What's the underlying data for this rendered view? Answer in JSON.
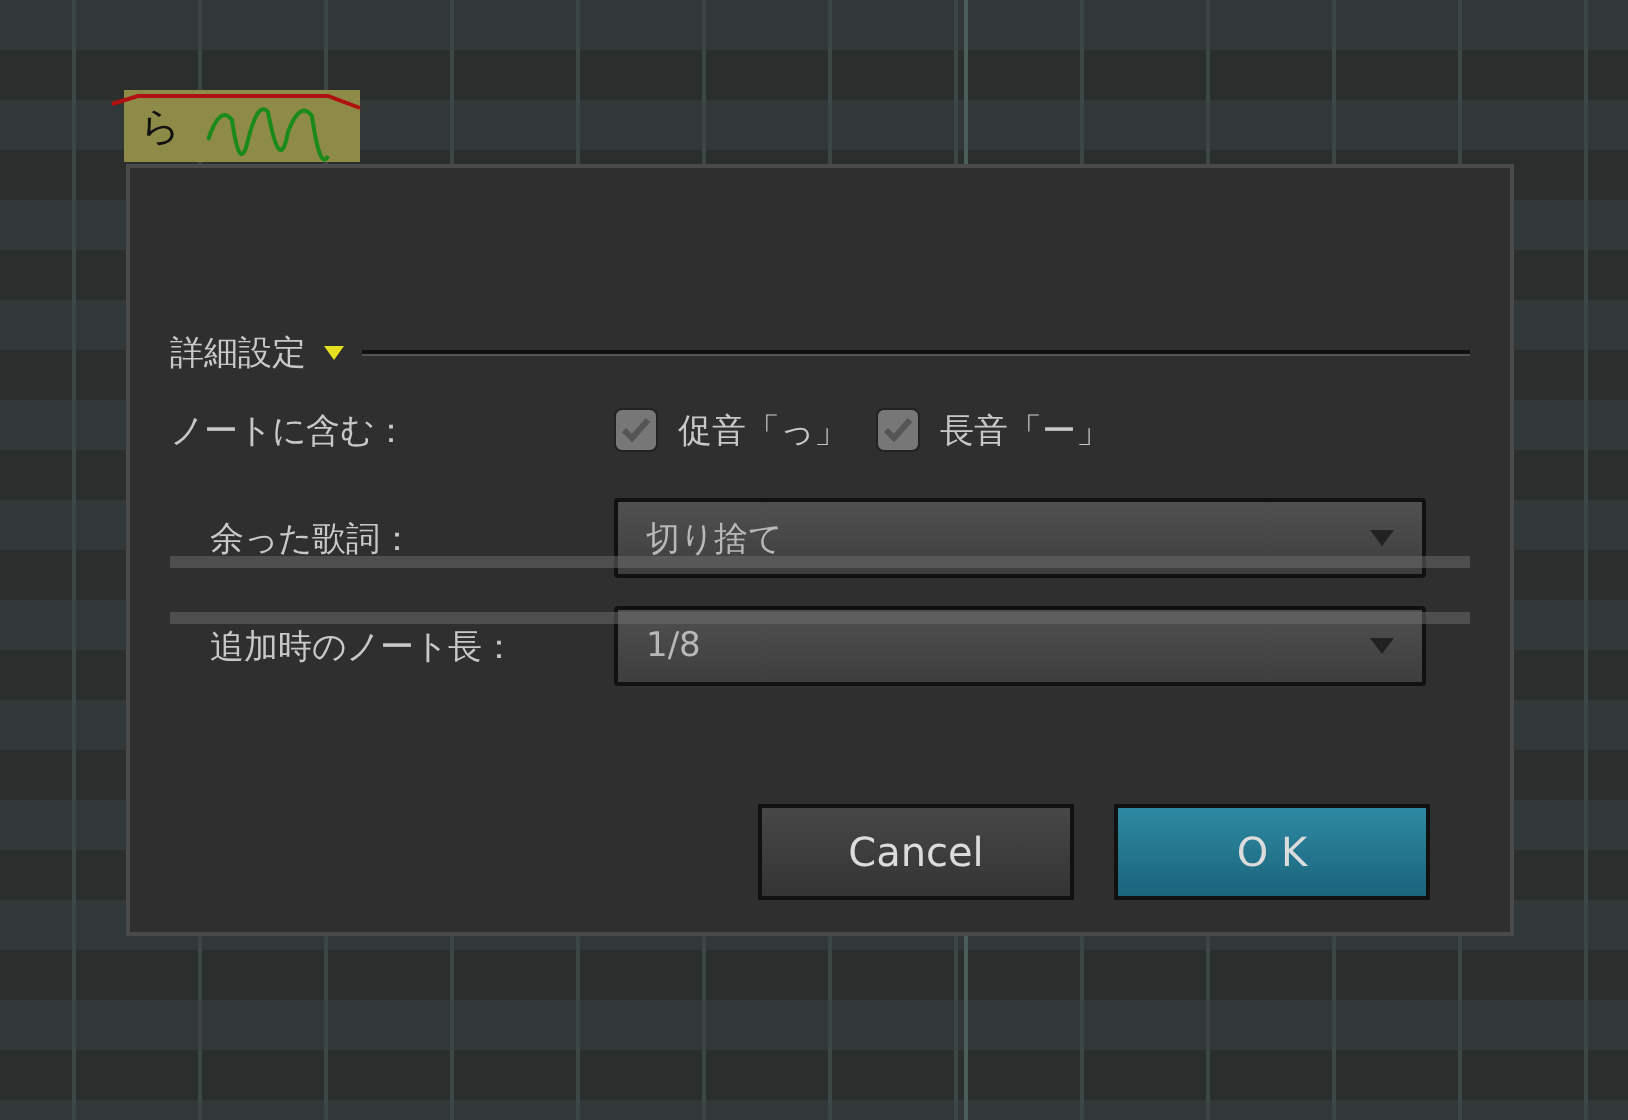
{
  "note": {
    "lyric": "ら"
  },
  "dialog": {
    "section_title": "詳細設定",
    "section_expanded": true,
    "include_label": "ノートに含む：",
    "include_options": [
      {
        "label": "促音「っ」",
        "checked": true
      },
      {
        "label": "長音「ー」",
        "checked": true
      }
    ],
    "selects": [
      {
        "label": "余った歌詞：",
        "value": "切り捨て"
      },
      {
        "label": "追加時のノート長：",
        "value": "1/8"
      }
    ],
    "buttons": [
      {
        "label": "Cancel",
        "kind": "secondary"
      },
      {
        "label": "O K",
        "kind": "primary"
      }
    ]
  }
}
